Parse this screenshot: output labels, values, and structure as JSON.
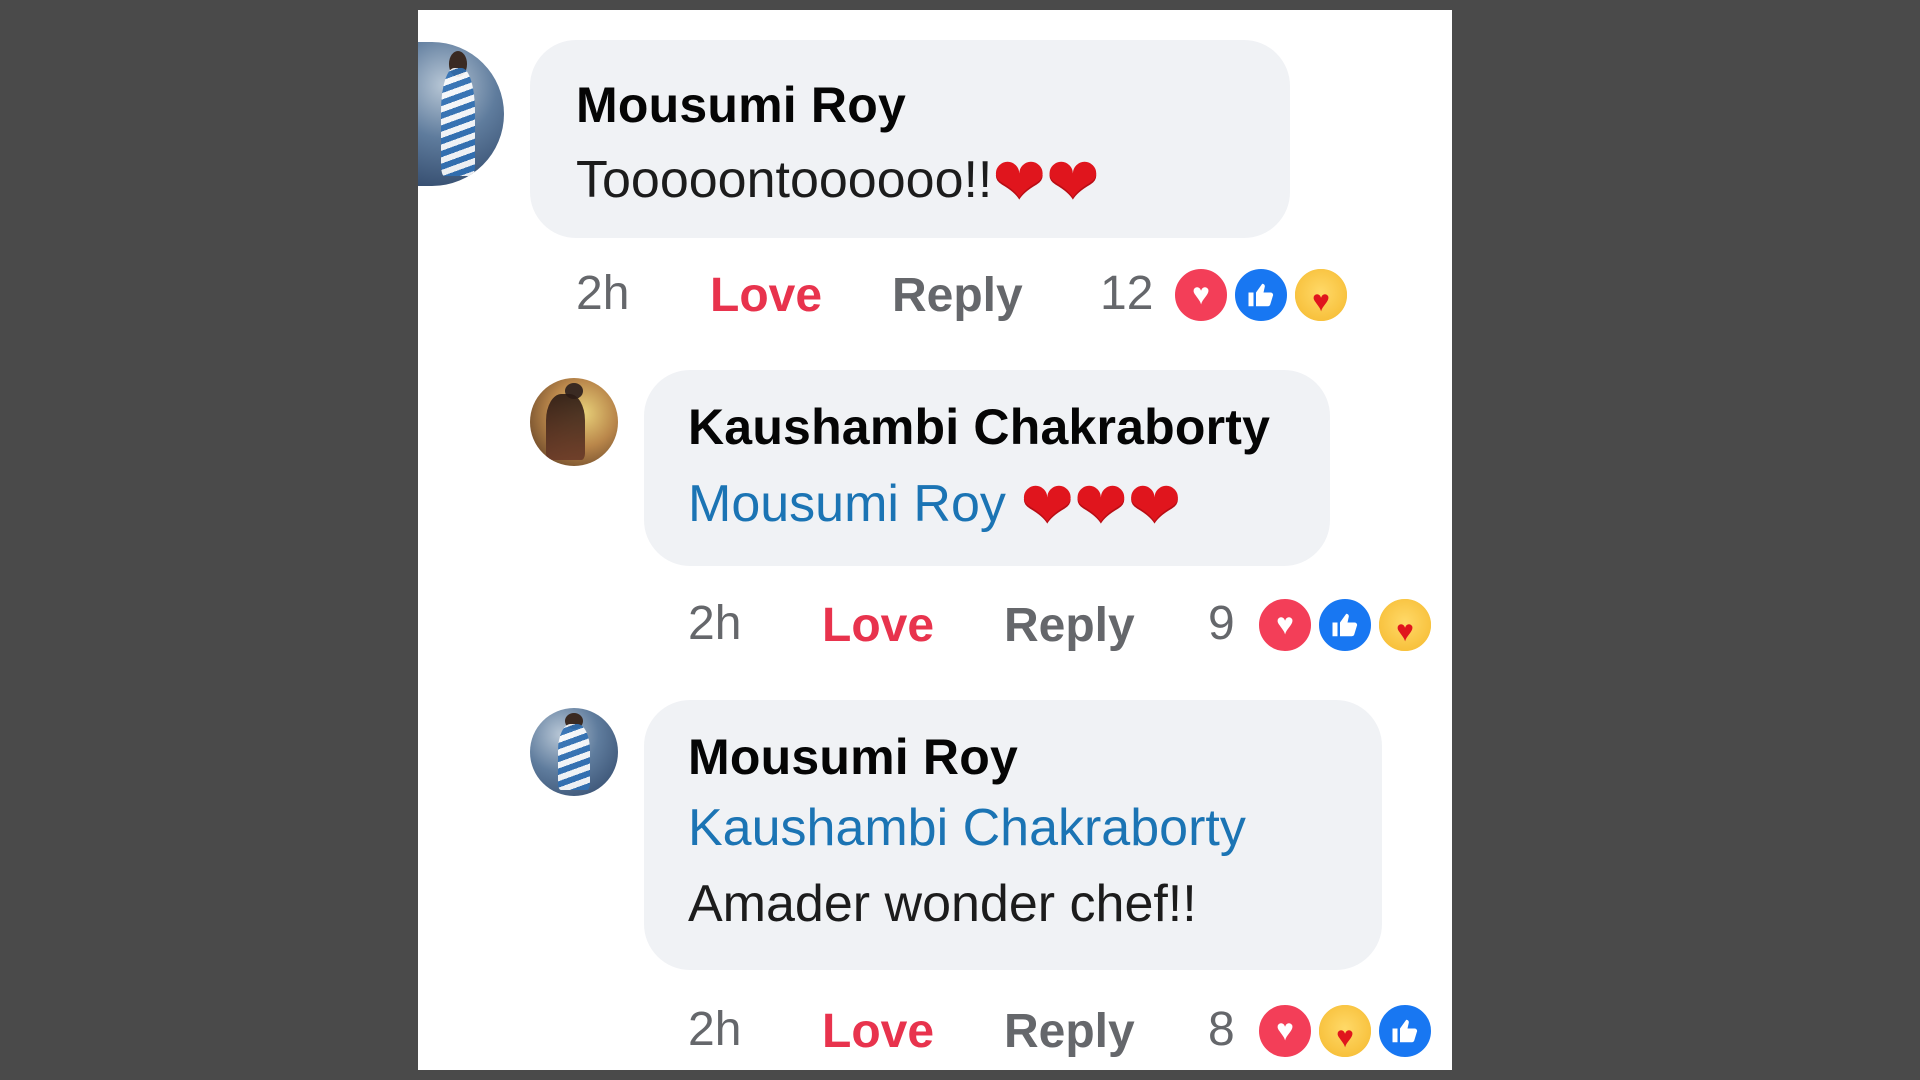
{
  "comments": [
    {
      "author": "Mousumi Roy",
      "text": "Tooooontoooooo!!",
      "mention": "",
      "emoji": "❤❤",
      "time": "2h",
      "love_label": "Love",
      "reply_label": "Reply",
      "reaction_count": "12",
      "reactions": [
        "heart-icon",
        "like-icon",
        "care-icon"
      ]
    },
    {
      "author": "Kaushambi Chakraborty",
      "mention": "Mousumi Roy",
      "text": "",
      "emoji": "❤❤❤",
      "time": "2h",
      "love_label": "Love",
      "reply_label": "Reply",
      "reaction_count": "9",
      "reactions": [
        "heart-icon",
        "like-icon",
        "care-icon"
      ]
    },
    {
      "author": "Mousumi Roy",
      "mention": "Kaushambi Chakraborty",
      "text": "Amader wonder chef!!",
      "emoji": "",
      "time": "2h",
      "love_label": "Love",
      "reply_label": "Reply",
      "reaction_count": "8",
      "reactions": [
        "heart-icon",
        "care-icon",
        "like-icon"
      ]
    }
  ],
  "colors": {
    "love": "#e8334d",
    "mention": "#1b74b4",
    "bubble": "#f0f2f5",
    "meta": "#65676b"
  }
}
